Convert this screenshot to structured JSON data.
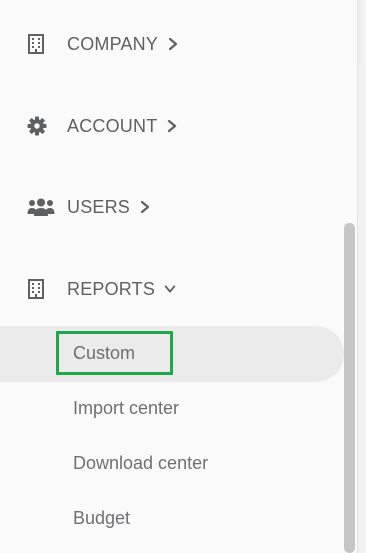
{
  "nav": {
    "items": [
      {
        "label": "COMPANY",
        "icon": "building-icon",
        "expanded": false
      },
      {
        "label": "ACCOUNT",
        "icon": "gear-icon",
        "expanded": false
      },
      {
        "label": "USERS",
        "icon": "users-icon",
        "expanded": false
      },
      {
        "label": "REPORTS",
        "icon": "building-icon",
        "expanded": true
      }
    ]
  },
  "reports_submenu": {
    "items": [
      {
        "label": "Custom",
        "selected": true
      },
      {
        "label": "Import center"
      },
      {
        "label": "Download center"
      },
      {
        "label": "Budget"
      }
    ]
  },
  "colors": {
    "text": "#5f6062",
    "subtext": "#6f7072",
    "selected_bg": "#ebebeb",
    "focus_outline": "#1fa84a"
  }
}
